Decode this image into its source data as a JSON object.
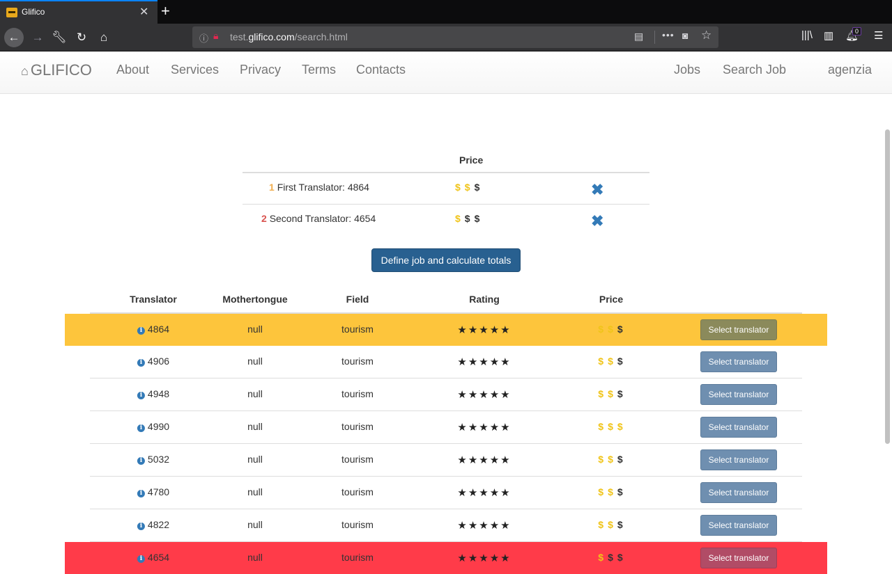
{
  "browser": {
    "tab_title": "Glifico",
    "url_prefix": "test.",
    "url_domain": "glifico.com",
    "url_path": "/search.html",
    "notification_count": "0"
  },
  "site": {
    "brand": "GLIFICO",
    "nav_left": [
      "About",
      "Services",
      "Privacy",
      "Terms",
      "Contacts"
    ],
    "nav_right": [
      "Jobs",
      "Search Job",
      "agenzia"
    ]
  },
  "selected": {
    "header_price": "Price",
    "rows": [
      {
        "rank": "1",
        "rank_color": "#f0ad4e",
        "name": "First Translator: 4864",
        "price": [
          1,
          1,
          0
        ]
      },
      {
        "rank": "2",
        "rank_color": "#d9534f",
        "name": "Second Translator: 4654",
        "price": [
          1,
          0,
          0
        ]
      }
    ],
    "remove_icon": "✖",
    "calc_button": "Define job and calculate totals"
  },
  "results": {
    "headers": {
      "translator": "Translator",
      "mothertongue": "Mothertongue",
      "field": "Field",
      "rating": "Rating",
      "price": "Price"
    },
    "select_label": "Select translator",
    "rows": [
      {
        "id": "4864",
        "mothertongue": "null",
        "field": "tourism",
        "rating": 5,
        "price": [
          1,
          1,
          0
        ],
        "highlight": "gold"
      },
      {
        "id": "4906",
        "mothertongue": "null",
        "field": "tourism",
        "rating": 5,
        "price": [
          1,
          1,
          0
        ],
        "highlight": ""
      },
      {
        "id": "4948",
        "mothertongue": "null",
        "field": "tourism",
        "rating": 5,
        "price": [
          1,
          1,
          0
        ],
        "highlight": ""
      },
      {
        "id": "4990",
        "mothertongue": "null",
        "field": "tourism",
        "rating": 5,
        "price": [
          1,
          1,
          1
        ],
        "highlight": ""
      },
      {
        "id": "5032",
        "mothertongue": "null",
        "field": "tourism",
        "rating": 5,
        "price": [
          1,
          1,
          0
        ],
        "highlight": ""
      },
      {
        "id": "4780",
        "mothertongue": "null",
        "field": "tourism",
        "rating": 5,
        "price": [
          1,
          1,
          0
        ],
        "highlight": ""
      },
      {
        "id": "4822",
        "mothertongue": "null",
        "field": "tourism",
        "rating": 5,
        "price": [
          1,
          1,
          0
        ],
        "highlight": ""
      },
      {
        "id": "4654",
        "mothertongue": "null",
        "field": "tourism",
        "rating": 5,
        "price": [
          1,
          0,
          0
        ],
        "highlight": "red"
      }
    ]
  }
}
